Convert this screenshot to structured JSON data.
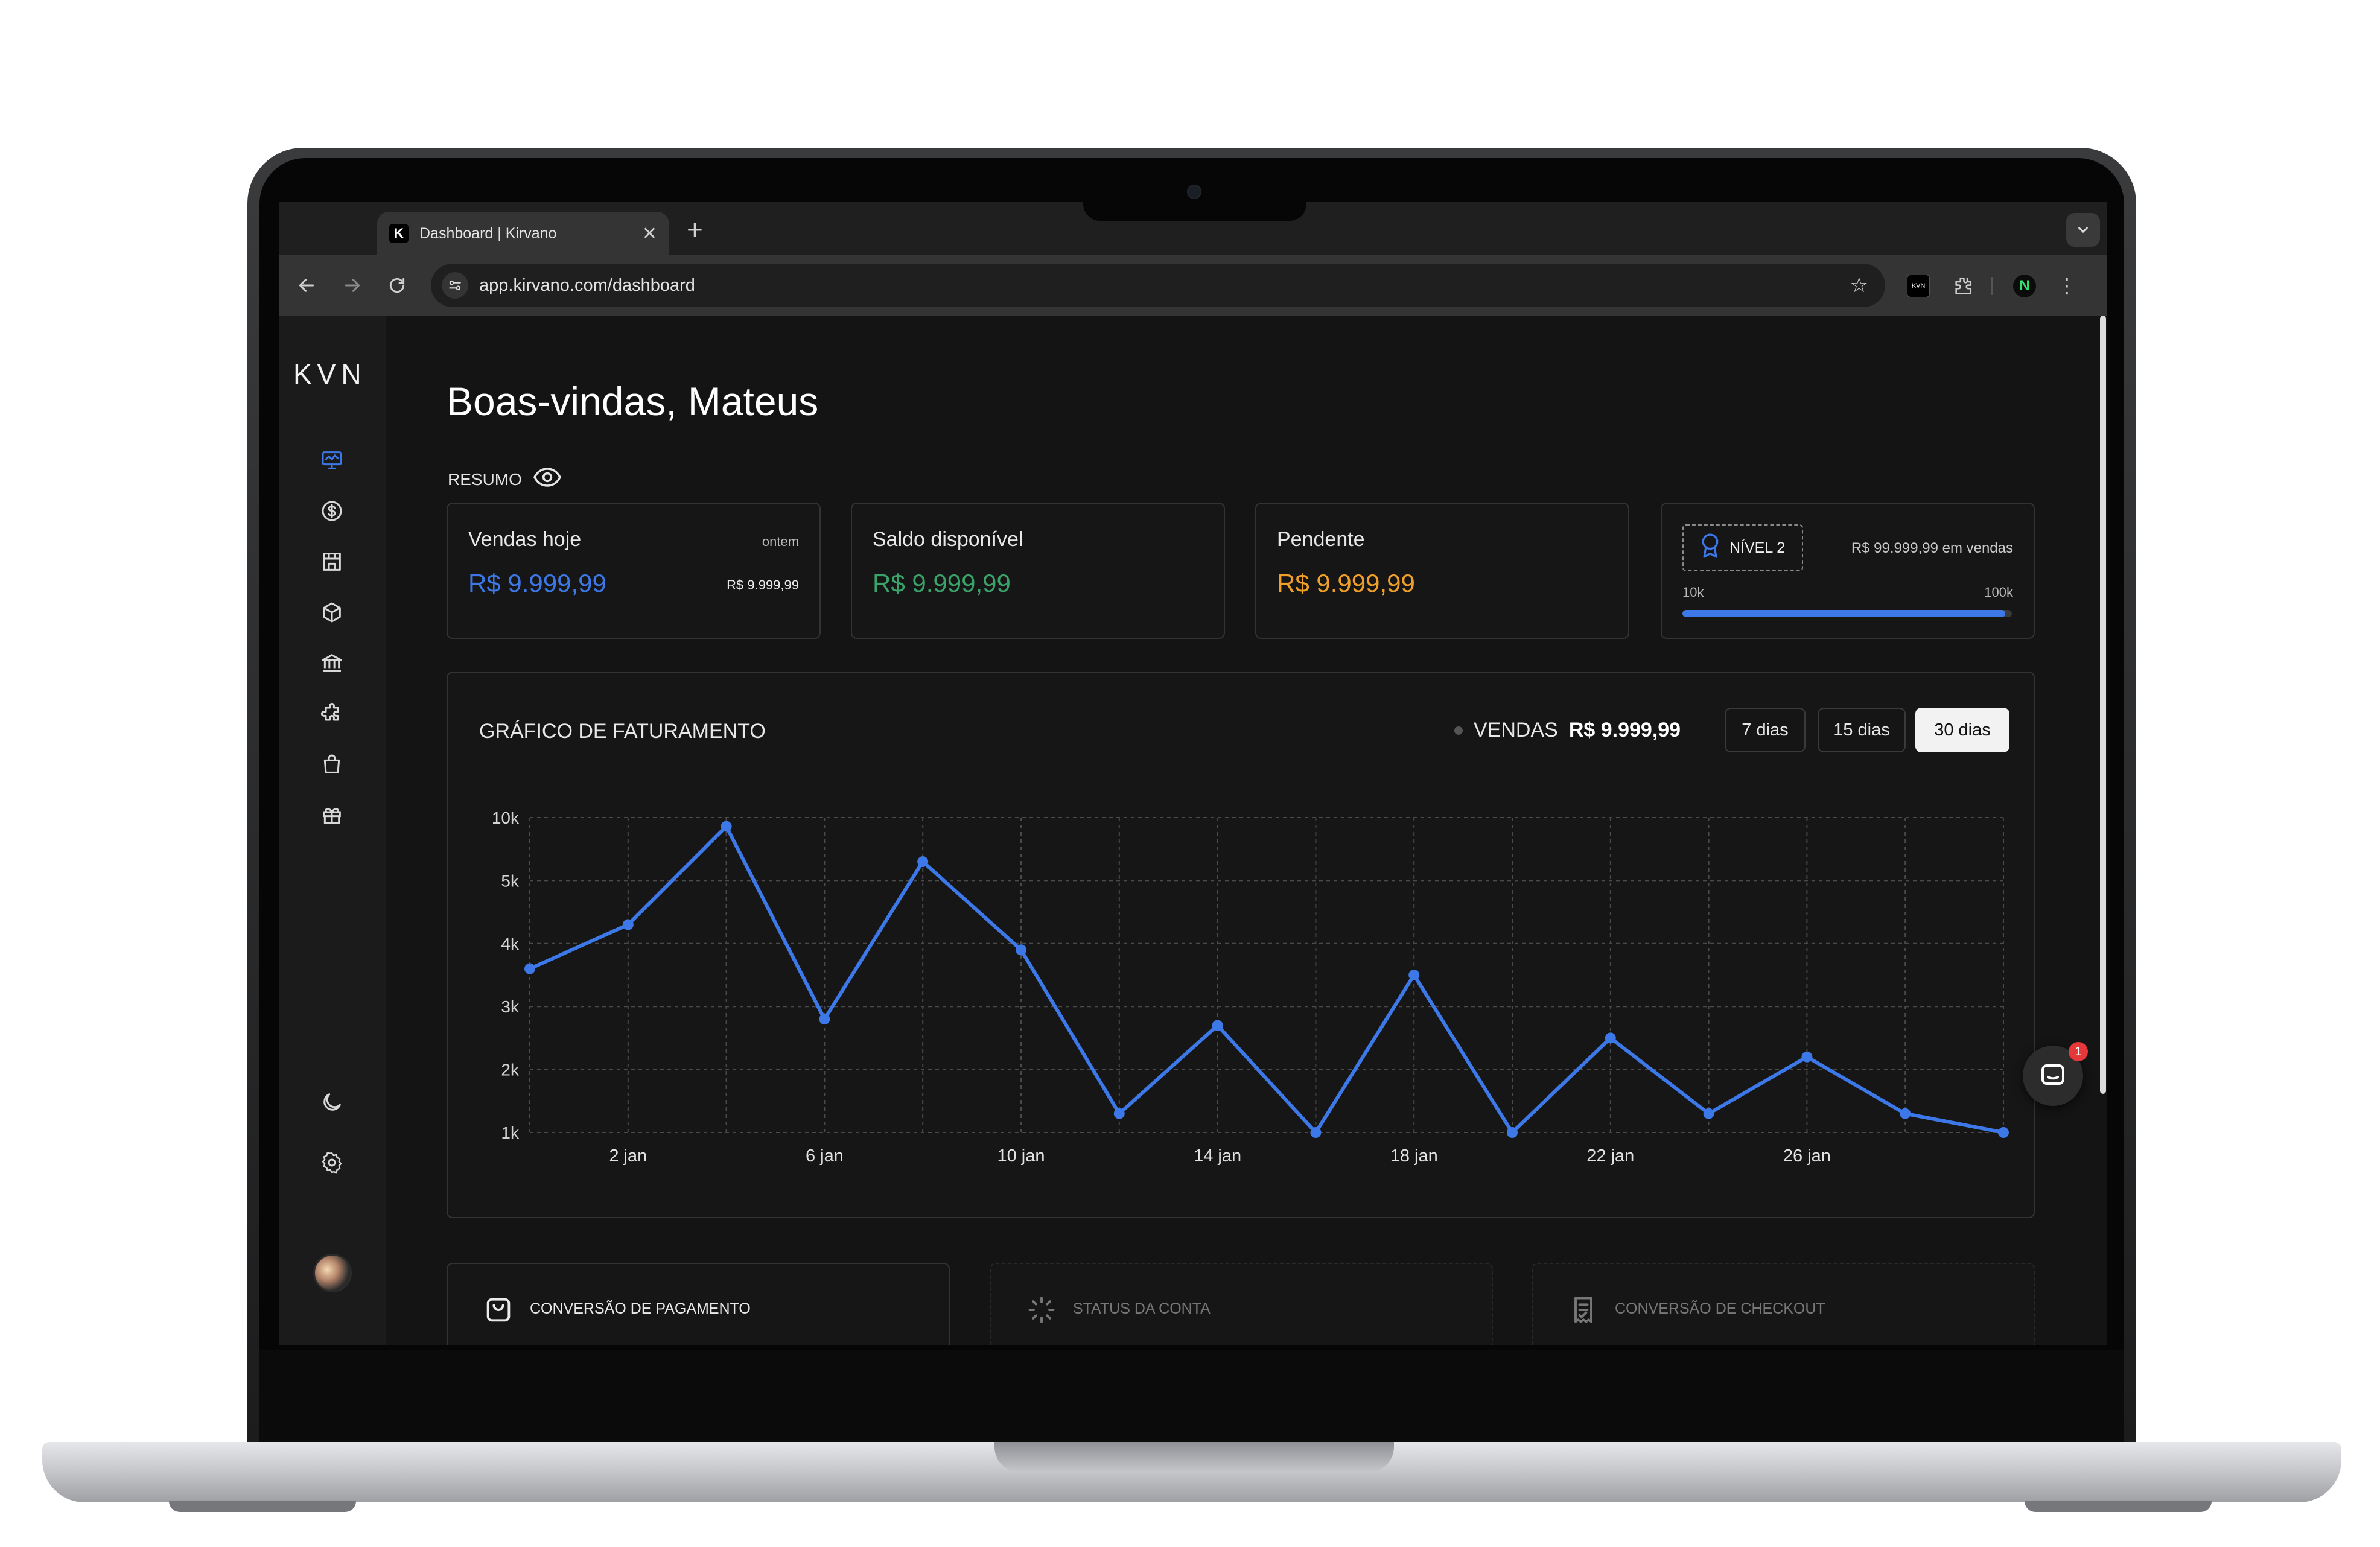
{
  "browser": {
    "tab_title": "Dashboard | Kirvano",
    "tab_favicon": "K",
    "url": "app.kirvano.com/dashboard",
    "profile_initial": "N",
    "extension_label": "KVN"
  },
  "sidebar": {
    "logo": "KVN",
    "items": [
      {
        "icon": "monitor-chart-icon",
        "active": true
      },
      {
        "icon": "dollar-icon"
      },
      {
        "icon": "store-icon"
      },
      {
        "icon": "package-icon"
      },
      {
        "icon": "bank-icon"
      },
      {
        "icon": "puzzle-icon"
      },
      {
        "icon": "shopping-bag-icon"
      },
      {
        "icon": "gift-icon"
      }
    ],
    "bottom_icons": [
      "moon-icon",
      "gear-icon"
    ]
  },
  "header": {
    "title": "Boas-vindas, Mateus",
    "summary_label": "RESUMO"
  },
  "cards": {
    "sales_today": {
      "label": "Vendas hoje",
      "value": "R$ 9.999,99",
      "compare_label": "ontem",
      "compare_value": "R$ 9.999,99",
      "color": "#3c78e8"
    },
    "balance": {
      "label": "Saldo disponível",
      "value": "R$ 9.999,99",
      "color": "#3aa36a"
    },
    "pending": {
      "label": "Pendente",
      "value": "R$ 9.999,99",
      "color": "#f0a02a"
    },
    "level": {
      "badge": "NÍVEL 2",
      "sales": "R$ 99.999,99 em vendas",
      "min": "10k",
      "max": "100k",
      "progress": 0.98
    }
  },
  "chart_card": {
    "title": "GRÁFICO DE FATURAMENTO",
    "legend_label": "VENDAS",
    "legend_value": "R$ 9.999,99",
    "ranges": [
      "7 dias",
      "15 dias",
      "30 dias"
    ],
    "active_range": "30 dias"
  },
  "chart_data": {
    "type": "line",
    "x_labels": [
      "2 jan",
      "6 jan",
      "10 jan",
      "14 jan",
      "18 jan",
      "22 jan",
      "26 jan"
    ],
    "y_ticks": [
      "10k",
      "5k",
      "4k",
      "3k",
      "2k",
      "1k"
    ],
    "x": [
      1,
      2,
      3,
      4,
      5,
      6,
      7,
      8,
      9,
      10,
      11,
      12,
      13,
      14,
      15,
      16
    ],
    "values": [
      3.6,
      4.3,
      9.3,
      2.8,
      6.5,
      3.9,
      1.3,
      2.7,
      1.0,
      3.5,
      1.0,
      2.5,
      1.3,
      2.2,
      1.3,
      1.0
    ],
    "series_color": "#3c78e8",
    "grid": true
  },
  "bottom_cards": [
    {
      "label": "CONVERSÃO DE PAGAMENTO",
      "icon": "shopping-bag-icon"
    },
    {
      "label": "STATUS DA CONTA",
      "icon": "spinner-icon"
    },
    {
      "label": "CONVERSÃO DE CHECKOUT",
      "icon": "receipt-icon"
    }
  ],
  "chat": {
    "badge_count": "1"
  }
}
